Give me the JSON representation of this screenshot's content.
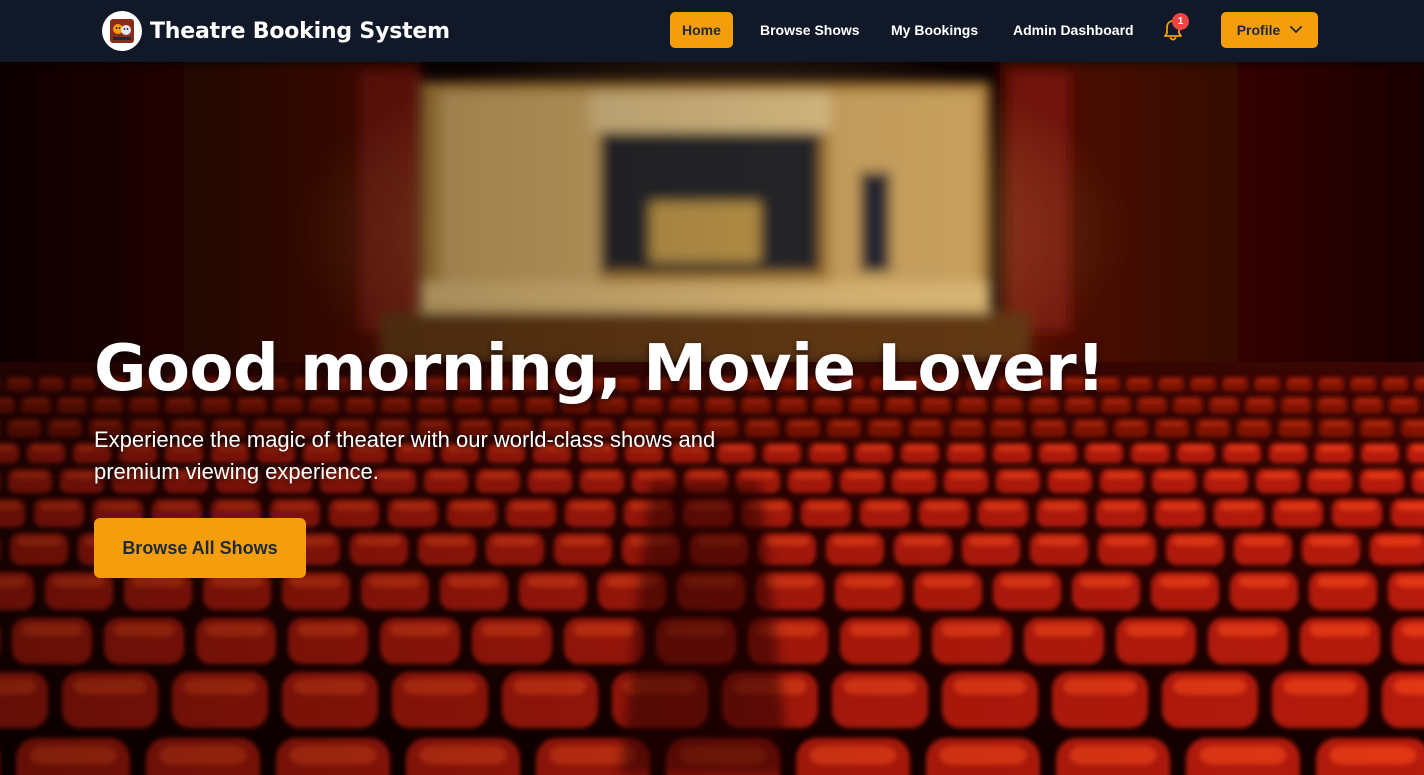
{
  "navbar": {
    "brand_title": "Theatre Booking System",
    "logo_icon": "theatre-masks-logo",
    "links": [
      {
        "label": "Home",
        "active": true
      },
      {
        "label": "Browse Shows",
        "active": false
      },
      {
        "label": "My Bookings",
        "active": false
      },
      {
        "label": "Admin Dashboard",
        "active": false
      }
    ],
    "notification_icon": "bell-icon",
    "notification_count": "1",
    "profile_label": "Profile",
    "profile_icon": "chevron-down-icon"
  },
  "hero": {
    "title": "Good morning, Movie Lover!",
    "subtitle": "Experience the magic of theater with our world-class shows and premium viewing experience.",
    "cta_label": "Browse All Shows",
    "background": "theater-auditorium-red-seats-image"
  },
  "colors": {
    "navbar_bg": "#111827",
    "accent": "#f59e0b",
    "badge": "#ef4444",
    "seat_red": "#c81e0a"
  }
}
